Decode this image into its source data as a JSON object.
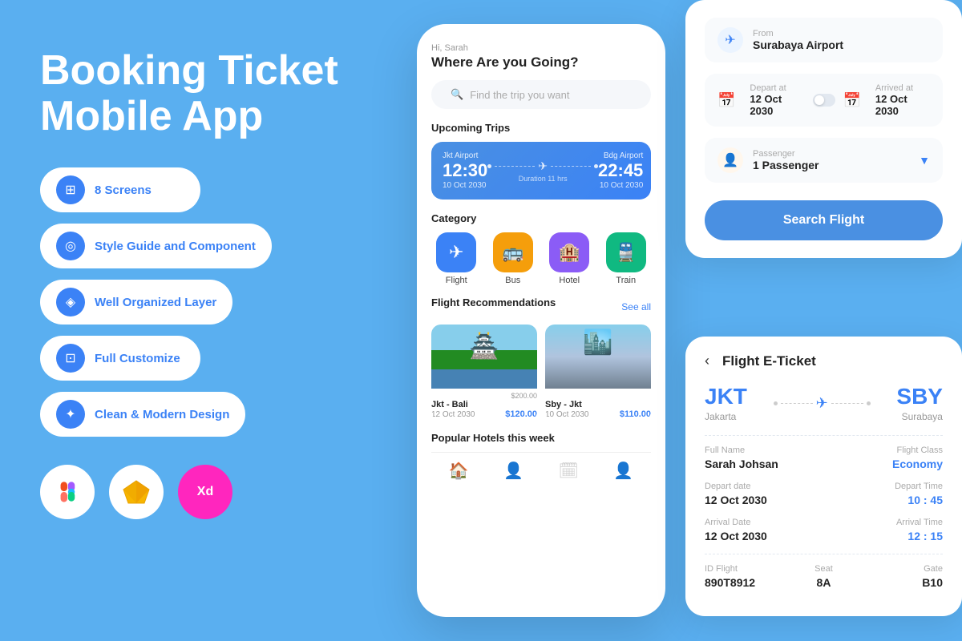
{
  "left": {
    "title_line1": "Booking Ticket",
    "title_line2": "Mobile App",
    "features": [
      {
        "id": "screens",
        "icon": "⊞",
        "text": "8 Screens"
      },
      {
        "id": "style",
        "icon": "◎",
        "text": "Style Guide and Component"
      },
      {
        "id": "layer",
        "icon": "◈",
        "text": "Well Organized Layer"
      },
      {
        "id": "customize",
        "icon": "⊡",
        "text": "Full Customize"
      },
      {
        "id": "design",
        "icon": "✦",
        "text": "Clean & Modern Design"
      }
    ],
    "tools": [
      {
        "id": "figma",
        "icon": "🎨"
      },
      {
        "id": "sketch",
        "icon": "💎"
      },
      {
        "id": "xd",
        "icon": "🟣"
      }
    ]
  },
  "phone": {
    "greeting": "Hi, Sarah",
    "title": "Where Are you Going?",
    "search_placeholder": "Find the trip you want",
    "upcoming_label": "Upcoming Trips",
    "trip": {
      "from_airport": "Jkt Airport",
      "to_airport": "Bdg Airport",
      "depart_time": "12:30",
      "arrive_time": "22:45",
      "depart_date": "10 Oct 2030",
      "arrive_date": "10 Oct 2030",
      "duration": "Duration 11 hrs"
    },
    "category_label": "Category",
    "categories": [
      {
        "id": "flight",
        "icon": "✈",
        "name": "Flight",
        "color": "blue"
      },
      {
        "id": "bus",
        "icon": "🚌",
        "name": "Bus",
        "color": "orange"
      },
      {
        "id": "hotel",
        "icon": "🏨",
        "name": "Hotel",
        "color": "purple"
      },
      {
        "id": "train",
        "icon": "🚆",
        "name": "Train",
        "color": "green"
      }
    ],
    "recommendations_label": "Flight Recommendations",
    "see_all": "See all",
    "recommendations": [
      {
        "id": "bali",
        "title": "Jkt - Bali",
        "date": "12 Oct 2030",
        "price": "$120.00",
        "original": "$200.00"
      },
      {
        "id": "jkt",
        "title": "Sby - Jkt",
        "date": "10 Oct 2030",
        "price": "$110.00",
        "original": ""
      }
    ],
    "popular_label": "Popular Hotels this week",
    "nav_icons": [
      "🏠",
      "👤",
      "🗓",
      "👤"
    ]
  },
  "booking_form": {
    "from_label": "From",
    "from_value": "Surabaya Airport",
    "depart_label": "Depart at",
    "depart_date": "12 Oct 2030",
    "arrived_label": "Arrived at",
    "arrived_date": "12 Oct 2030",
    "passenger_label": "Passenger",
    "passenger_value": "1 Passenger",
    "search_button": "Search Flight"
  },
  "eticket": {
    "back_icon": "‹",
    "title": "Flight E-Ticket",
    "from_code": "JKT",
    "from_city": "Jakarta",
    "to_code": "SBY",
    "to_city": "Surabaya",
    "full_name_label": "Full Name",
    "full_name_value": "Sarah Johsan",
    "flight_class_label": "Flight Class",
    "flight_class_value": "Economy",
    "depart_date_label": "Depart date",
    "depart_date_value": "12 Oct 2030",
    "depart_time_label": "Depart Time",
    "depart_time_value": "10 : 45",
    "arrival_date_label": "Arrival Date",
    "arrival_date_value": "12 Oct 2030",
    "arrival_time_label": "Arrival Time",
    "arrival_time_value": "12 : 15",
    "id_flight_label": "ID Flight",
    "id_flight_value": "890T8912",
    "seat_label": "Seat",
    "seat_value": "8A",
    "gate_label": "Gate",
    "gate_value": "B10"
  }
}
